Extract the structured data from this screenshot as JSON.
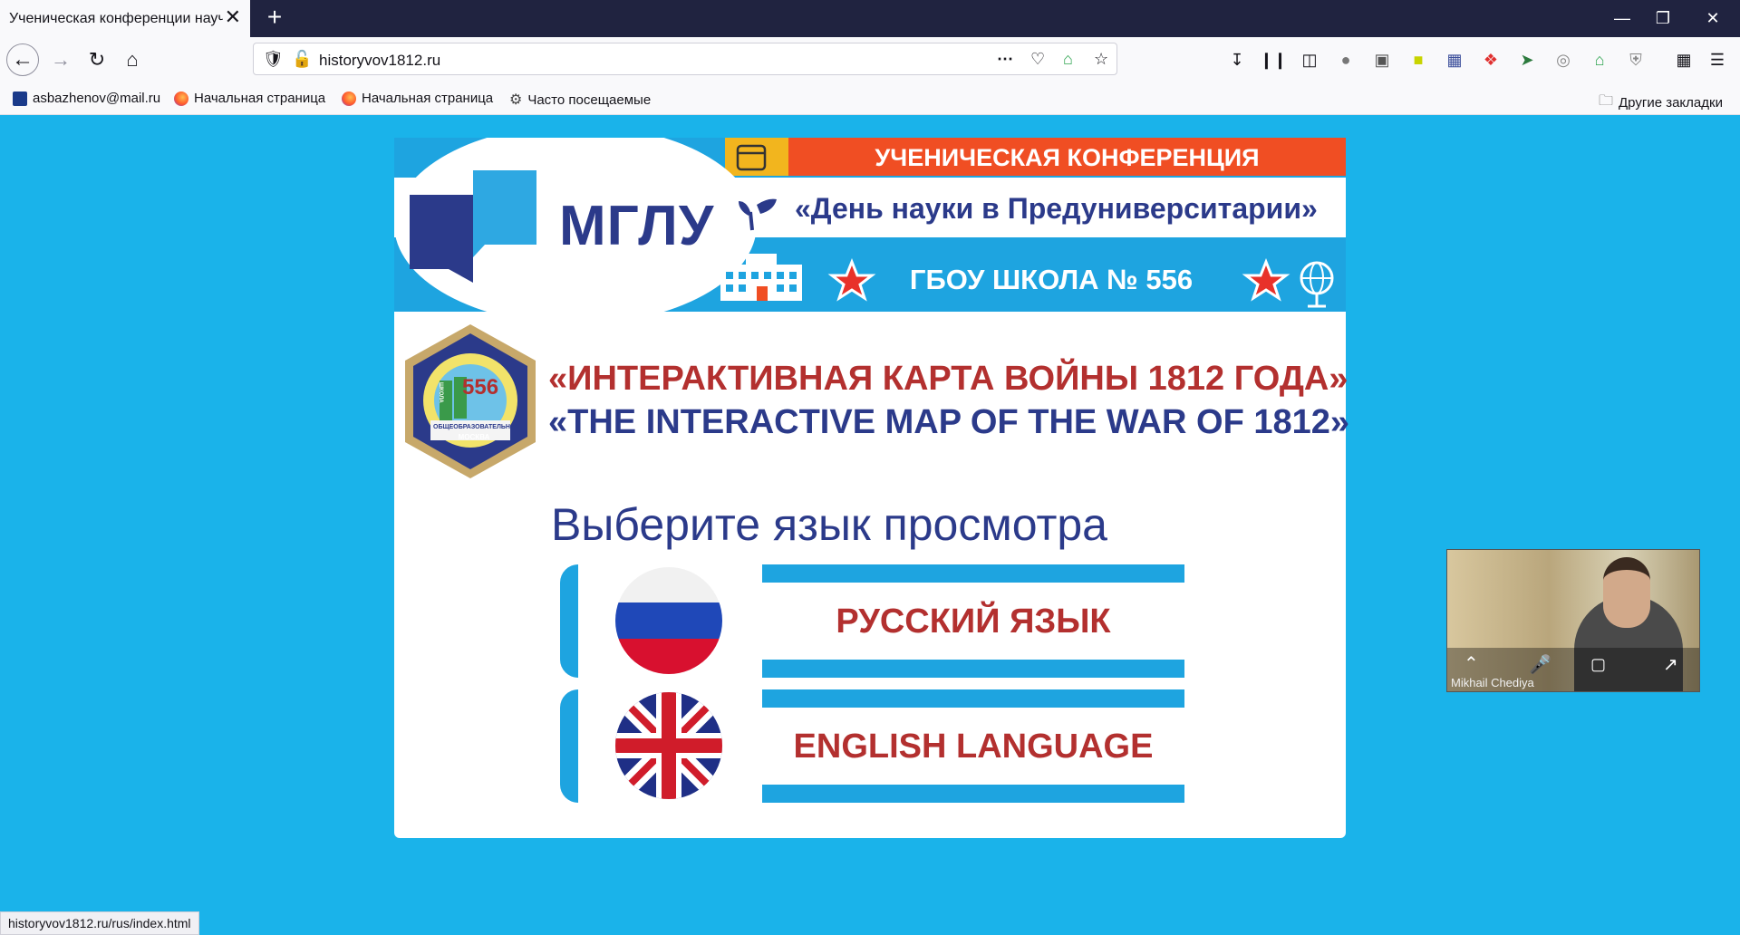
{
  "browser": {
    "tab_title": "Ученическая конференции научн",
    "tab_close": "✕",
    "new_tab": "+",
    "url": "historyvov1812.ru",
    "status_url": "historyvov1812.ru/rus/index.html"
  },
  "bookmarks": {
    "items": [
      {
        "label": "asbazhenov@mail.ru"
      },
      {
        "label": "Начальная страница"
      },
      {
        "label": "Начальная страница"
      },
      {
        "label": "Часто посещаемые"
      }
    ],
    "other": "Другие закладки"
  },
  "banner": {
    "conference": "УЧЕНИЧЕСКАЯ КОНФЕРЕНЦИЯ",
    "university": "МГЛУ",
    "day_of_science": "«День науки в Предуниверситарии»",
    "school": "ГБОУ ШКОЛА № 556"
  },
  "page": {
    "title_ru": "«ИНТЕРАКТИВНАЯ КАРТА ВОЙНЫ 1812 ГОДА»",
    "title_en": "«THE INTERACTIVE MAP OF THE WAR OF 1812»",
    "choose_language": "Выберите язык просмотра",
    "lang_ru": "РУССКИЙ ЯЗЫК",
    "lang_en": "ENGLISH LANGUAGE"
  },
  "emblem": {
    "number": "556",
    "text1": "ОБЩЕОБРАЗОВАТЕЛЬНАЯ",
    "text2": "МОСКВА",
    "text3": "ШКОЛА"
  },
  "video": {
    "participant": "Mikhail Chediya"
  },
  "colors": {
    "page_bg": "#1ab3ea",
    "banner_blue": "#1ea4e0",
    "navy": "#2b3a8a",
    "red": "#b3302f",
    "orange": "#f04e23",
    "yellow": "#f2b51e"
  }
}
